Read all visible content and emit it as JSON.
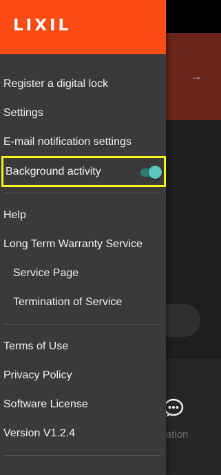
{
  "app": {
    "brand": "LIXIL",
    "accent_color": "#fa4c14",
    "toggle_color": "#5cc7be",
    "highlight_color": "#f5f51a"
  },
  "background_app": {
    "arrow_icon": "arrow-right-icon",
    "chat_icon": "chat-bubble-icon",
    "bottom_label": "ication"
  },
  "drawer": {
    "section1": [
      {
        "label": "Register a digital lock"
      },
      {
        "label": "Settings"
      },
      {
        "label": "E-mail notification settings"
      }
    ],
    "background_activity": {
      "label": "Background activity",
      "enabled": true
    },
    "section2": [
      {
        "label": "Help"
      },
      {
        "label": "Long Term Warranty Service"
      },
      {
        "label": "Service Page"
      },
      {
        "label": "Termination of Service"
      }
    ],
    "section3": [
      {
        "label": "Terms of Use"
      },
      {
        "label": "Privacy Policy"
      },
      {
        "label": "Software License"
      },
      {
        "label": "Version V1.2.4"
      }
    ]
  }
}
